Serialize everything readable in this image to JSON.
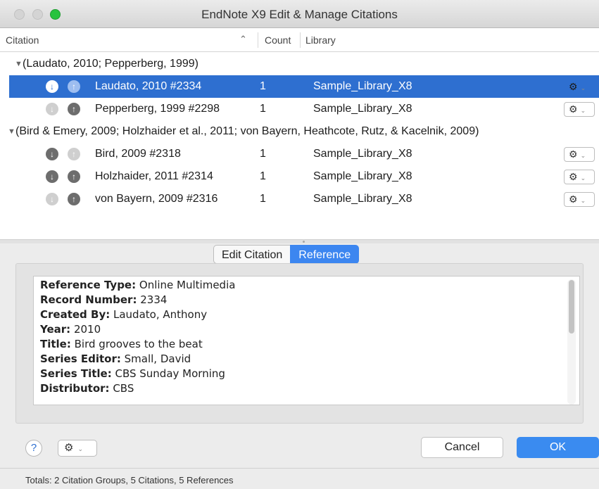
{
  "window": {
    "title": "EndNote X9 Edit & Manage Citations"
  },
  "table": {
    "columns": {
      "citation": "Citation",
      "count": "Count",
      "library": "Library"
    },
    "groups": [
      {
        "label": "(Laudato, 2010; Pepperberg, 1999)",
        "citations": [
          {
            "name": "Laudato, 2010 #2334",
            "count": "1",
            "library": "Sample_Library_X8"
          },
          {
            "name": "Pepperberg, 1999 #2298",
            "count": "1",
            "library": "Sample_Library_X8"
          }
        ]
      },
      {
        "label": "(Bird & Emery, 2009; Holzhaider et al., 2011; von Bayern, Heathcote, Rutz, & Kacelnik, 2009)",
        "citations": [
          {
            "name": "Bird, 2009 #2318",
            "count": "1",
            "library": "Sample_Library_X8"
          },
          {
            "name": "Holzhaider, 2011 #2314",
            "count": "1",
            "library": "Sample_Library_X8"
          },
          {
            "name": "von Bayern, 2009 #2316",
            "count": "1",
            "library": "Sample_Library_X8"
          }
        ]
      }
    ]
  },
  "tabs": {
    "edit_citation": "Edit Citation",
    "reference": "Reference"
  },
  "reference": {
    "fields": [
      {
        "label": "Reference Type:",
        "value": "Online Multimedia"
      },
      {
        "label": "Record Number:",
        "value": "2334"
      },
      {
        "label": "Created By:",
        "value": "Laudato, Anthony"
      },
      {
        "label": "Year:",
        "value": "2010"
      },
      {
        "label": "Title:",
        "value": "Bird grooves to the beat"
      },
      {
        "label": "Series Editor:",
        "value": "Small, David"
      },
      {
        "label": "Series Title:",
        "value": "CBS Sunday Morning"
      },
      {
        "label": "Distributor:",
        "value": "CBS"
      }
    ]
  },
  "footer": {
    "help": "?",
    "cancel": "Cancel",
    "ok": "OK"
  },
  "status": {
    "totals": "Totals: 2 Citation Groups, 5 Citations, 5 References"
  },
  "colors": {
    "selection": "#2e6fd0",
    "accent_button": "#3a8bf0"
  }
}
